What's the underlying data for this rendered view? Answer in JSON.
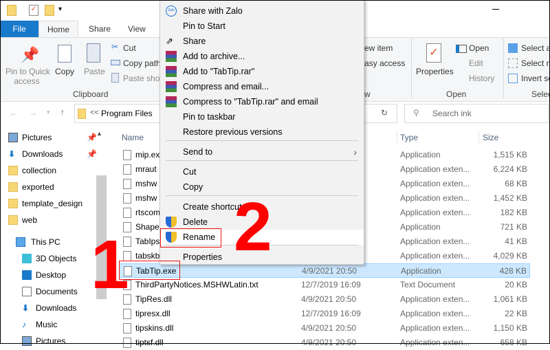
{
  "ribbon": {
    "tabs": [
      "File",
      "Home",
      "Share",
      "View"
    ],
    "clipboard": {
      "pin": "Pin to Quick access",
      "pin_l1": "Pin to Quick",
      "pin_l2": "access",
      "copy": "Copy",
      "paste": "Paste",
      "cut": "Cut",
      "copy_path": "Copy path",
      "paste_shortcut": "Paste shor",
      "group": "Clipboard"
    },
    "new": {
      "new_item": "ew item",
      "easy_access": "asy access",
      "group": "w"
    },
    "open": {
      "properties": "Properties",
      "open": "Open",
      "edit": "Edit",
      "history": "History",
      "group": "Open"
    },
    "select": {
      "select_all": "Select al",
      "select_none": "Select n",
      "invert": "Invert se",
      "group": "Selec"
    }
  },
  "address": {
    "prefix": "<<",
    "path": "Program Files"
  },
  "search": {
    "placeholder": "Search ink"
  },
  "nav": {
    "items": [
      "Pictures",
      "Downloads",
      "collection",
      "exported",
      "template_design",
      "web",
      "This PC",
      "3D Objects",
      "Desktop",
      "Documents",
      "Downloads",
      "Music",
      "Pictures"
    ]
  },
  "columns": {
    "name": "Name",
    "type": "Type",
    "size": "Size"
  },
  "files": [
    {
      "name": "mip.exe",
      "date": "",
      "type": "Application",
      "size": "1,515 KB"
    },
    {
      "name": "mraut",
      "date": "",
      "type": "Application exten...",
      "size": "6,224 KB"
    },
    {
      "name": "mshw",
      "date": "",
      "type": "Application exten...",
      "size": "68 KB"
    },
    {
      "name": "mshw",
      "date": "",
      "type": "Application exten...",
      "size": "1,452 KB"
    },
    {
      "name": "rtscom",
      "date": "",
      "type": "Application exten...",
      "size": "182 KB"
    },
    {
      "name": "Shape",
      "date": "",
      "type": "Application",
      "size": "721 KB"
    },
    {
      "name": "TabIps",
      "date": "",
      "type": "Application exten...",
      "size": "41 KB"
    },
    {
      "name": "tabskb",
      "date": "",
      "type": "Application exten...",
      "size": "4,029 KB"
    },
    {
      "name": "TabTip.exe",
      "date": "4/9/2021 20:50",
      "type": "Application",
      "size": "428 KB",
      "selected": true
    },
    {
      "name": "ThirdPartyNotices.MSHWLatin.txt",
      "date": "12/7/2019 16:09",
      "type": "Text Document",
      "size": "20 KB"
    },
    {
      "name": "TipRes.dll",
      "date": "4/9/2021 20:50",
      "type": "Application exten...",
      "size": "1,061 KB"
    },
    {
      "name": "tipresx.dll",
      "date": "12/7/2019 16:09",
      "type": "Application exten...",
      "size": "22 KB"
    },
    {
      "name": "tipskins.dll",
      "date": "4/9/2021 20:50",
      "type": "Application exten...",
      "size": "1,150 KB"
    },
    {
      "name": "tiptsf.dll",
      "date": "4/9/2021 20:50",
      "type": "Application exten...",
      "size": "658 KB"
    }
  ],
  "context_menu": [
    {
      "label": "Share with Zalo",
      "icon": "zalo-icon"
    },
    {
      "label": "Pin to Start"
    },
    {
      "label": "Share",
      "icon": "share-icon"
    },
    {
      "label": "Add to archive...",
      "icon": "winrar-icon"
    },
    {
      "label": "Add to \"TabTip.rar\"",
      "icon": "winrar-icon"
    },
    {
      "label": "Compress and email...",
      "icon": "winrar-icon"
    },
    {
      "label": "Compress to \"TabTip.rar\" and email",
      "icon": "winrar-icon"
    },
    {
      "label": "Pin to taskbar"
    },
    {
      "label": "Restore previous versions"
    },
    {
      "label": "Send to",
      "submenu": true
    },
    {
      "label": "Cut"
    },
    {
      "label": "Copy"
    },
    {
      "label": "Create shortcut"
    },
    {
      "label": "Delete",
      "icon": "shield-icon"
    },
    {
      "label": "Rename",
      "icon": "shield-icon",
      "highlighted": true
    },
    {
      "label": "Properties"
    }
  ],
  "annotations": {
    "step1": "1",
    "step2": "2",
    "color": "#ff0000"
  }
}
